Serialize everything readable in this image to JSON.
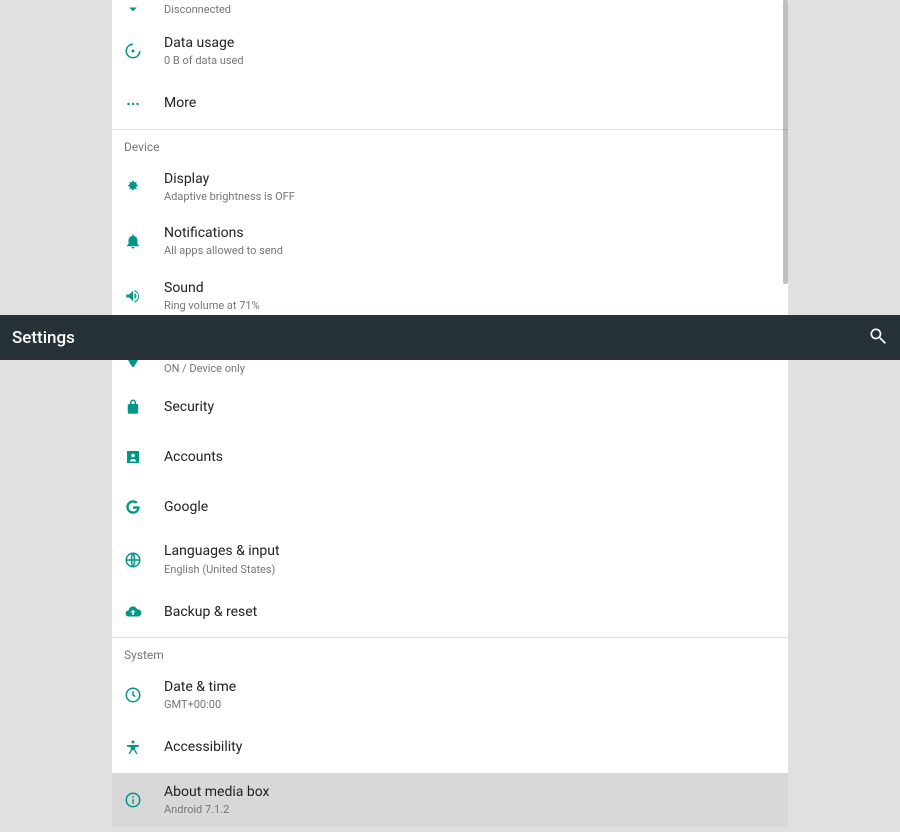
{
  "topbar": {
    "title": "Settings"
  },
  "sections": {
    "wireless": {
      "items": [
        {
          "title": "",
          "sub": "Disconnected",
          "icon": "arrow-down"
        },
        {
          "title": "Data usage",
          "sub": "0 B of data used",
          "icon": "data-usage"
        },
        {
          "title": "More",
          "sub": "",
          "icon": "more"
        }
      ]
    },
    "device": {
      "header": "Device",
      "items": [
        {
          "title": "Display",
          "sub": "Adaptive brightness is OFF",
          "icon": "display"
        },
        {
          "title": "Notifications",
          "sub": "All apps allowed to send",
          "icon": "bell"
        },
        {
          "title": "Sound",
          "sub": "Ring volume at 71%",
          "icon": "sound"
        }
      ]
    },
    "personal": {
      "location": {
        "title": "",
        "sub": "ON / Device only",
        "icon": "location"
      },
      "security": {
        "title": "Security",
        "icon": "lock"
      },
      "accounts": {
        "title": "Accounts",
        "icon": "account"
      },
      "google": {
        "title": "Google",
        "icon": "google"
      },
      "lang": {
        "title": "Languages & input",
        "sub": "English (United States)",
        "icon": "globe"
      },
      "backup": {
        "title": "Backup & reset",
        "icon": "backup"
      }
    },
    "system": {
      "header": "System",
      "datetime": {
        "title": "Date & time",
        "sub": "GMT+00:00",
        "icon": "clock"
      },
      "accessibility": {
        "title": "Accessibility",
        "icon": "accessibility"
      },
      "about": {
        "title": "About media box",
        "sub": "Android 7.1.2",
        "icon": "info"
      }
    }
  }
}
